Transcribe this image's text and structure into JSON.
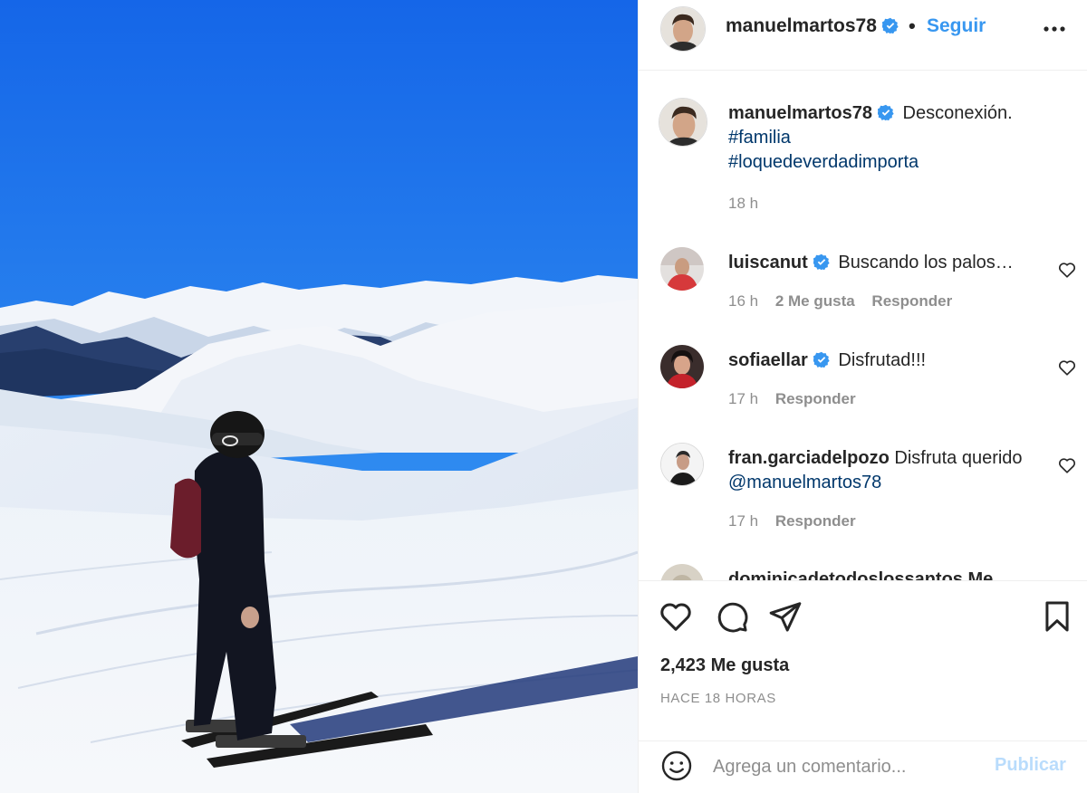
{
  "post": {
    "author": "manuelmartos78",
    "follow_label": "Seguir",
    "separator": "•",
    "more_icon": "more-options-icon",
    "verified_icon": "verified-badge-icon"
  },
  "caption": {
    "username": "manuelmartos78",
    "text": "Desconexión.",
    "hashtag_1": "#familia",
    "hashtag_2": "#loquedeverdadimporta",
    "time": "18 h"
  },
  "comments": [
    {
      "username": "luiscanut",
      "verified": true,
      "text": "Buscando los palos…",
      "time": "16 h",
      "likes": "2 Me gusta",
      "reply": "Responder"
    },
    {
      "username": "sofiaellar",
      "verified": true,
      "text": "Disfrutad!!!",
      "time": "17 h",
      "reply": "Responder"
    },
    {
      "username": "fran.garciadelpozo",
      "verified": false,
      "text": "Disfruta querido",
      "mention": "@manuelmartos78",
      "time": "17 h",
      "reply": "Responder"
    },
    {
      "username": "dominicadetodoslossantos Me"
    }
  ],
  "actions": {
    "like_icon": "heart-icon",
    "comment_icon": "comment-icon",
    "share_icon": "share-icon",
    "save_icon": "bookmark-icon",
    "likes_count": "2,423 Me gusta",
    "posted_ago": "HACE 18 HORAS"
  },
  "comment_box": {
    "placeholder": "Agrega un comentario...",
    "publish_label": "Publicar",
    "emoji_icon": "emoji-icon"
  },
  "colors": {
    "link_blue": "#3897f0",
    "hashtag": "#00376b",
    "secondary_text": "#8e8e8e",
    "publish_disabled": "#b9dcfc"
  }
}
